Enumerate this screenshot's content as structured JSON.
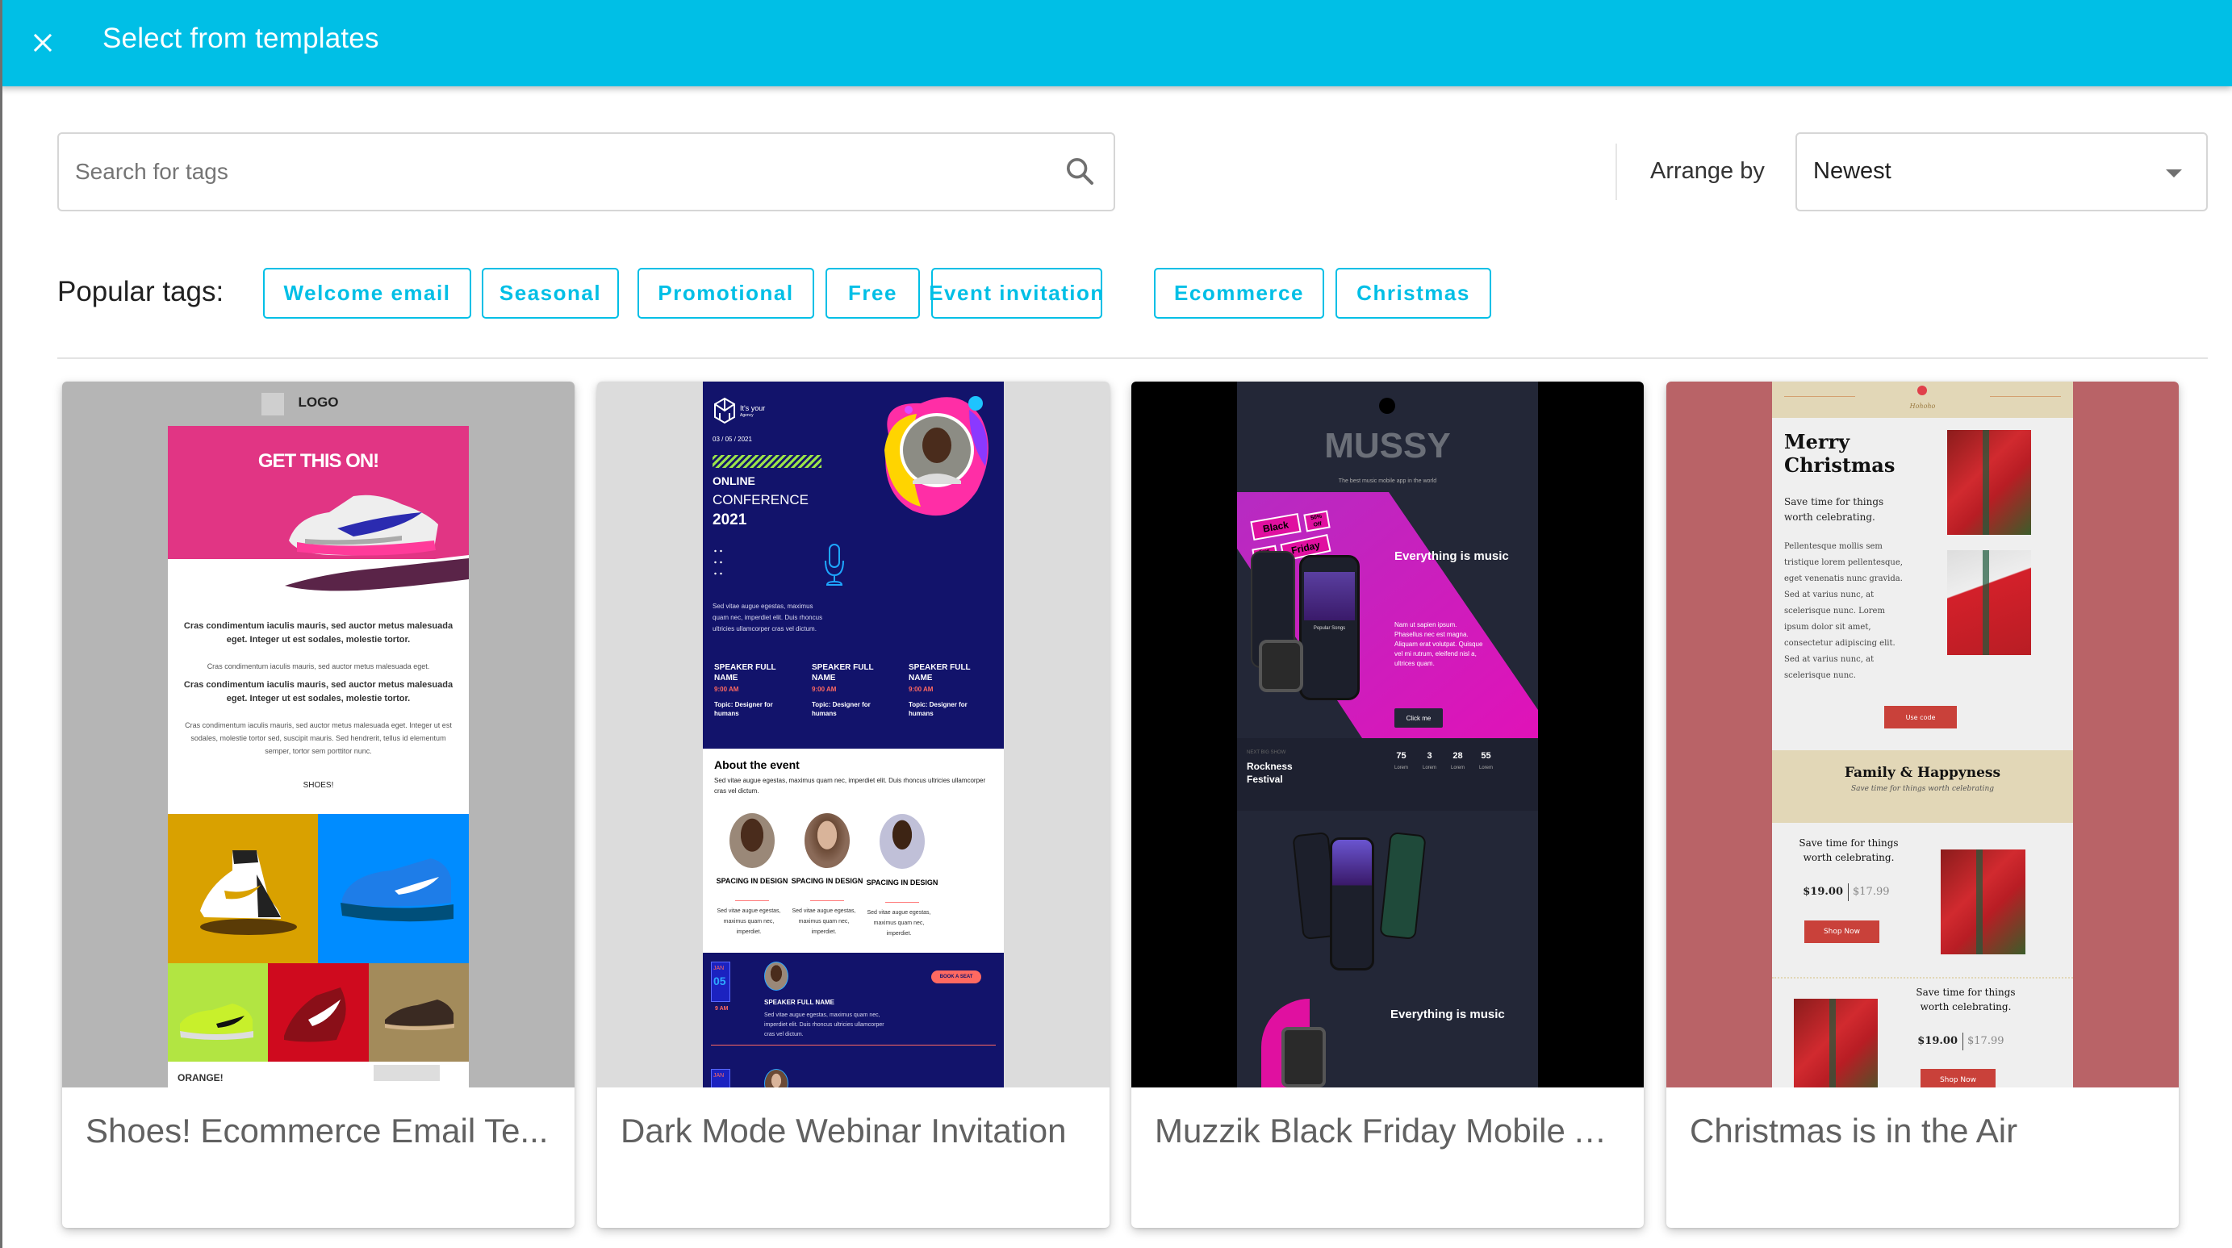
{
  "header": {
    "close_icon": "close-icon",
    "title": "Select from templates",
    "accent_color": "#00bfe6"
  },
  "search": {
    "placeholder": "Search for tags",
    "value": "",
    "icon": "search-icon"
  },
  "arrange": {
    "label": "Arrange by",
    "selected": "Newest",
    "icon": "caret-down-icon"
  },
  "popular_tags": {
    "label": "Popular tags:",
    "tags": [
      "Welcome email",
      "Seasonal",
      "Promotional",
      "Free",
      "Event invitation",
      "Ecommerce",
      "Christmas"
    ]
  },
  "templates": [
    {
      "name": "Shoes! Ecommerce Email Te...",
      "preview": {
        "logo": "LOGO",
        "hero_title": "GET THIS ON!",
        "heading_1": "Cras condimentum iaculis mauris, sed auctor metus malesuada eget. Integer ut est sodales, molestie tortor.",
        "body_1": "Cras condimentum iaculis mauris, sed auctor metus malesuada eget.",
        "heading_2": "Cras condimentum iaculis mauris, sed auctor metus malesuada eget. Integer ut est sodales, molestie tortor.",
        "body_2": "Cras condimentum iaculis mauris, sed auctor metus malesuada eget. Integer ut est sodales, molestie tortor sed, suscipit mauris. Sed hendrerit, tellus id elementum semper, tortor sem porttitor nunc.",
        "cta": "SHOES!",
        "footer_label": "ORANGE!"
      }
    },
    {
      "name": "Dark Mode Webinar Invitation",
      "preview": {
        "brand": "It's your",
        "brand_sub": "Agency",
        "date": "03 / 05 / 2021",
        "title_1": "ONLINE",
        "title_2": "CONFERENCE",
        "title_3": "2021",
        "intro": "Sed vitae augue egestas, maximus quam nec, imperdiet elit. Duis rhoncus ultricies ullamcorper cras vel dictum.",
        "speakers": [
          {
            "name": "SPEAKER FULL NAME",
            "time": "9:00 AM",
            "topic": "Topic: Designer for humans"
          },
          {
            "name": "SPEAKER FULL NAME",
            "time": "9:00 AM",
            "topic": "Topic: Designer for humans"
          },
          {
            "name": "SPEAKER FULL NAME",
            "time": "9:00 AM",
            "topic": "Topic: Designer for humans"
          }
        ],
        "about_title": "About the event",
        "about_text": "Sed vitae augue egestas, maximus quam nec, imperdiet elit. Duis rhoncus ultricies ullamcorper cras vel dictum.",
        "sessions": [
          {
            "title": "SPACING IN DESIGN",
            "text": "Sed vitae augue egestas, maximus quam nec, imperdiet."
          },
          {
            "title": "SPACING IN DESIGN",
            "text": "Sed vitae augue egestas, maximus quam nec, imperdiet."
          },
          {
            "title": "SPACING IN DESIGN",
            "text": "Sed vitae augue egestas, maximus quam nec, imperdiet."
          }
        ],
        "agenda": {
          "month": "JAN",
          "day": "05",
          "time": "9 AM",
          "speaker": "SPEAKER FULL NAME",
          "text": "Sed vitae augue egestas, maximus quam nec, imperdiet elit. Duis rhoncus ultricies ullamcorper cras vel dictum.",
          "button": "BOOK A SEAT",
          "next_month": "JAN"
        }
      }
    },
    {
      "name": "Muzzik Black Friday Mobile A...",
      "preview": {
        "brand": "MUSSY",
        "tagline": "The best music mobile app in the world",
        "badge_1": "Black",
        "badge_2": "Friday",
        "badge_3": "50% Off",
        "badge_4": "Free trials",
        "headline": "Everything is music",
        "body": "Nam ut sapien ipsum. Phasellus nec est magna. Aliquam erat volutpat. Quisque vel mi rutrum, eleifend nisl a, ultrices quam.",
        "button": "Click me",
        "next_show_label": "NEXT BIG SHOW",
        "next_show": "Rockness Festival",
        "countdown": [
          {
            "value": "75",
            "label": "Lorem"
          },
          {
            "value": "3",
            "label": "Lorem"
          },
          {
            "value": "28",
            "label": "Lorem"
          },
          {
            "value": "55",
            "label": "Lorem"
          }
        ],
        "phone_caption": "Popular Songs",
        "headline_2": "Everything is music"
      }
    },
    {
      "name": "Christmas is in the Air",
      "preview": {
        "brand": "Hohoho",
        "title": "Merry Christmas",
        "subtitle": "Save time for things worth celebrating.",
        "body": "Pellentesque mollis sem tristique lorem pellentesque, eget venenatis nunc gravida. Sed at varius nunc, at scelerisque nunc. Lorem ipsum dolor sit amet, consectetur adipiscing elit. Sed at varius nunc, at scelerisque nunc.",
        "code_button": "Use code",
        "section_title": "Family & Happyness",
        "section_subtitle": "Save time for things worth celebrating",
        "products": [
          {
            "text": "Save time for things worth celebrating.",
            "price": "$19.00",
            "sale_price": "$17.99",
            "button": "Shop Now"
          },
          {
            "text": "Save time for things worth celebrating.",
            "price": "$19.00",
            "sale_price": "$17.99",
            "button": "Shop Now"
          }
        ]
      }
    }
  ]
}
